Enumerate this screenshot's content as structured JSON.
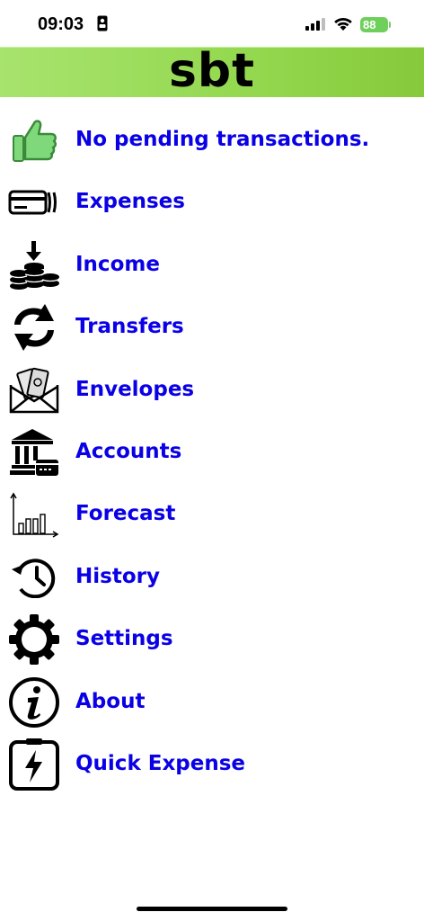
{
  "status_bar": {
    "time": "09:03",
    "battery": "88"
  },
  "header": {
    "title": "sbt",
    "gradient_colors": [
      "#a7e36e",
      "#86c93c"
    ]
  },
  "menu": {
    "label_color": "#0a00e6",
    "items": [
      {
        "label": "No pending transactions.",
        "icon": "thumbs-up-icon"
      },
      {
        "label": "Expenses",
        "icon": "credit-cards-icon"
      },
      {
        "label": "Income",
        "icon": "coins-download-icon"
      },
      {
        "label": "Transfers",
        "icon": "transfer-arrows-icon"
      },
      {
        "label": "Envelopes",
        "icon": "money-envelope-icon"
      },
      {
        "label": "Accounts",
        "icon": "bank-icon"
      },
      {
        "label": "Forecast",
        "icon": "bar-chart-icon"
      },
      {
        "label": "History",
        "icon": "history-clock-icon"
      },
      {
        "label": "Settings",
        "icon": "gear-icon"
      },
      {
        "label": "About",
        "icon": "info-icon"
      },
      {
        "label": "Quick Expense",
        "icon": "quick-expense-bolt-icon"
      }
    ]
  }
}
